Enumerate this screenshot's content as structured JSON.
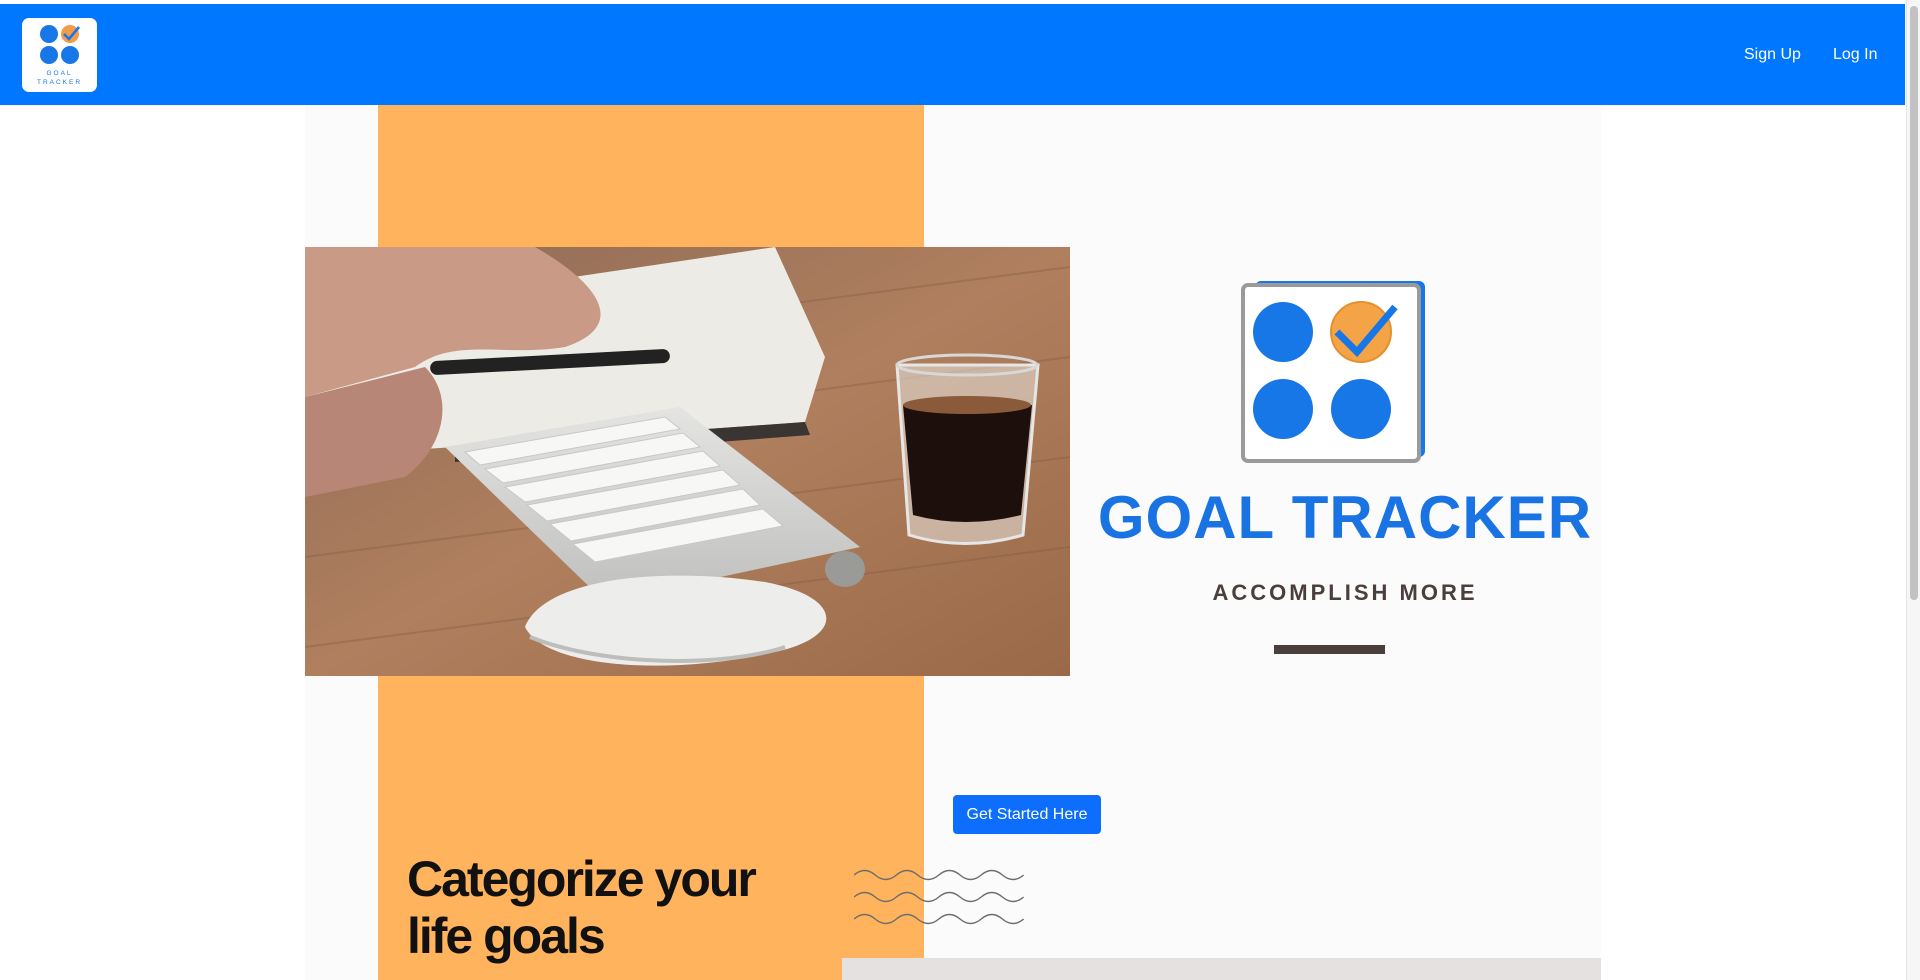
{
  "nav": {
    "logo_alt": "Goal Tracker logo",
    "logo_line1": "GOAL",
    "logo_line2": "TRACKER",
    "links": [
      {
        "label": "Sign Up"
      },
      {
        "label": "Log In"
      }
    ]
  },
  "hero": {
    "brand_title": "GOAL TRACKER",
    "brand_tagline": "ACCOMPLISH MORE",
    "cta_label": "Get Started Here",
    "section_heading": "Categorize your life goals",
    "photo_description": "desk-with-keyboard-mouse-notebook-and-espresso"
  },
  "colors": {
    "nav_bg": "#0077ff",
    "accent_blue": "#1a73e2",
    "accent_orange": "#ffb35c",
    "tagline": "#4a3f3c",
    "button_bg": "#0d6efd"
  }
}
